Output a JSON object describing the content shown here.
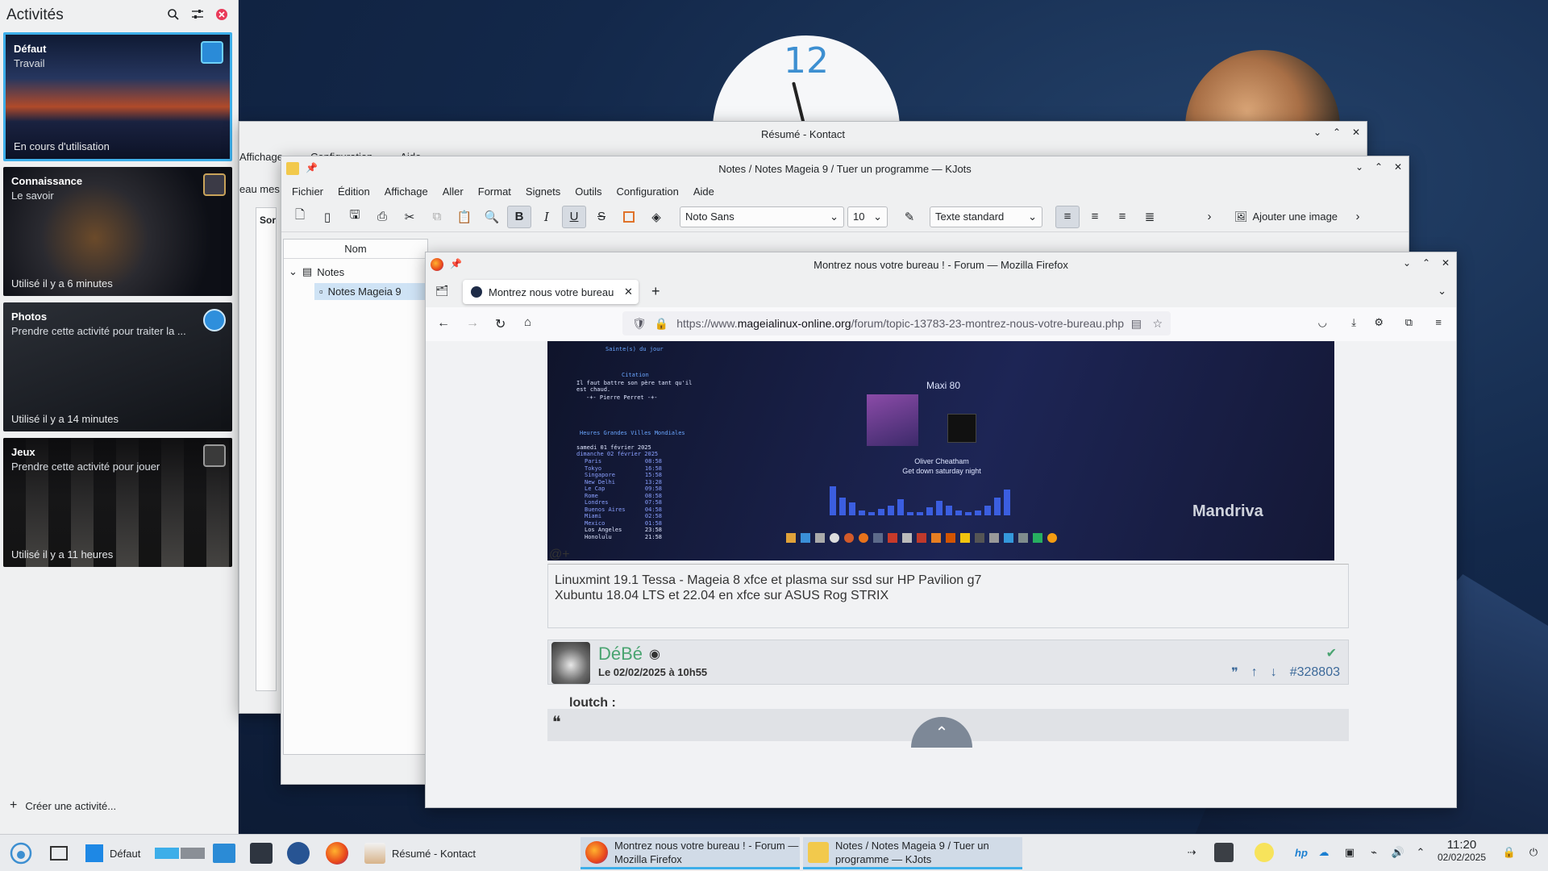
{
  "activities": {
    "title": "Activités",
    "items": [
      {
        "name": "Défaut",
        "desc": "Travail",
        "status": "En cours d'utilisation"
      },
      {
        "name": "Connaissance",
        "desc": "Le savoir",
        "status": "Utilisé il y a 6 minutes"
      },
      {
        "name": "Photos",
        "desc": "Prendre cette activité pour traiter la ...",
        "status": "Utilisé il y a 14 minutes"
      },
      {
        "name": "Jeux",
        "desc": "Prendre cette activité pour jouer",
        "status": "Utilisé il y a 11 heures"
      }
    ],
    "create_label": "Créer une activité..."
  },
  "kontact": {
    "title": "Résumé - Kontact",
    "menu_partial": [
      "Affichage",
      "Configuration",
      "Aide"
    ],
    "side_partial_1": "eau mes",
    "side_partial_2": "Sor"
  },
  "kjots": {
    "title": "Notes / Notes Mageia 9 / Tuer un programme — KJots",
    "menu": [
      "Fichier",
      "Édition",
      "Affichage",
      "Aller",
      "Format",
      "Signets",
      "Outils",
      "Configuration",
      "Aide"
    ],
    "font": "Noto Sans",
    "size": "10",
    "style": "Texte standard",
    "add_image": "Ajouter une image",
    "tree_header": "Nom",
    "tree_root": "Notes",
    "tree_child": "Notes Mageia 9"
  },
  "firefox": {
    "title": "Montrez nous votre bureau ! - Forum — Mozilla Firefox",
    "tab_label": "Montrez nous votre bureau",
    "url_prefix": "https://www.",
    "url_domain": "mageialinux-online.org",
    "url_path": "/forum/topic-13783-23-montrez-nous-votre-bureau.php",
    "screenshot": {
      "player": "Maxi 80",
      "artist": "Oliver Cheatham",
      "song": "Get down saturday night",
      "brand": "Mandriva",
      "saint": "Sainte(s) du jour",
      "citation_title": "Citation",
      "citation_text": "Il faut battre son père tant qu'il est chaud.",
      "citation_author": "-+- Pierre Perret -+-",
      "cities_title": "Heures Grandes Villes Mondiales",
      "date1": "samedi 01 février 2025",
      "date2": "dimanche 02 février 2025",
      "cities": [
        {
          "name": "Paris",
          "time": "08:58"
        },
        {
          "name": "Tokyo",
          "time": "16:58"
        },
        {
          "name": "Singapore",
          "time": "15:58"
        },
        {
          "name": "New Delhi",
          "time": "13:28"
        },
        {
          "name": "Le Cap",
          "time": "09:58"
        },
        {
          "name": "Rome",
          "time": "08:58"
        },
        {
          "name": "Londres",
          "time": "07:58"
        },
        {
          "name": "Buenos Aires",
          "time": "04:58"
        },
        {
          "name": "Miami",
          "time": "02:58"
        },
        {
          "name": "Mexico",
          "time": "01:58"
        },
        {
          "name": "Los Angeles",
          "time": "23:58"
        },
        {
          "name": "Honolulu",
          "time": "21:58"
        }
      ]
    },
    "at_plus": "@+",
    "sig_line1": "Linuxmint 19.1 Tessa - Mageia 8 xfce et plasma sur ssd sur HP Pavilion g7",
    "sig_line2": "Xubuntu 18.04 LTS et 22.04 en xfce sur ASUS Rog STRIX",
    "post_author": "DéBé",
    "post_date": "Le 02/02/2025 à 10h55",
    "post_id": "#328803",
    "quote_author": "loutch :"
  },
  "taskbar": {
    "activity": "Défaut",
    "tasks": [
      {
        "label": "Résumé - Kontact"
      },
      {
        "label": "Montrez nous votre bureau ! - Forum — Mozilla Firefox"
      },
      {
        "label": "Notes / Notes Mageia 9 / Tuer un programme — KJots"
      }
    ],
    "time": "11:20",
    "date": "02/02/2025"
  },
  "desktop": {
    "clock_number": "12"
  },
  "colors": {
    "accent": "#3daee9",
    "forum_green": "#4aa471",
    "forum_blue": "#3d6a9a"
  }
}
